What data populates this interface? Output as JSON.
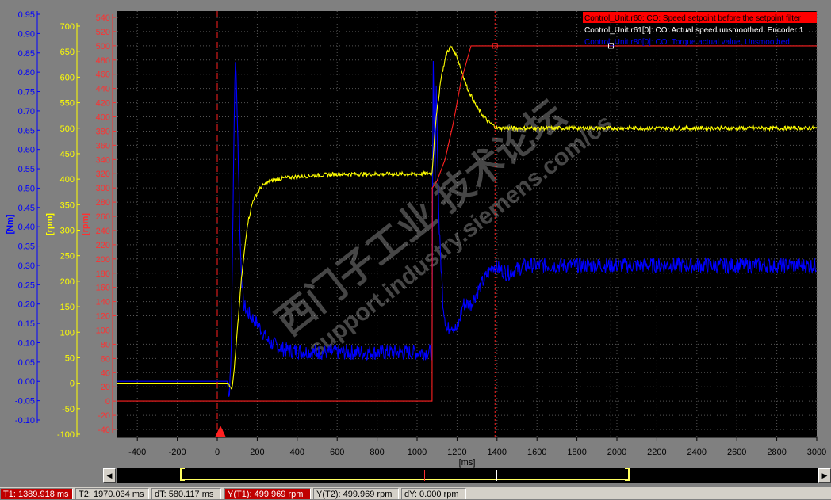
{
  "chart_data": {
    "type": "line",
    "x": {
      "label": "[ms]",
      "range": [
        -500,
        3000
      ],
      "ticks": [
        "-400",
        "-200",
        "0",
        "200",
        "400",
        "600",
        "800",
        "1000",
        "1200",
        "1400",
        "1600",
        "1800",
        "2000",
        "2200",
        "2400",
        "2600",
        "2800",
        "3000"
      ]
    },
    "axes": {
      "torque": {
        "label": "[Nm]",
        "color": "#0000ff",
        "range": [
          -0.1,
          0.95
        ],
        "ticks": [
          "0.95",
          "0.90",
          "0.85",
          "0.80",
          "0.75",
          "0.70",
          "0.65",
          "0.60",
          "0.55",
          "0.50",
          "0.45",
          "0.40",
          "0.35",
          "0.30",
          "0.25",
          "0.20",
          "0.15",
          "0.10",
          "0.05",
          "0.00",
          "-0.05",
          "-0.10"
        ]
      },
      "speed": {
        "label": "[rpm]",
        "color": "#ffff00",
        "range": [
          -100,
          700
        ],
        "ticks": [
          "700",
          "650",
          "600",
          "550",
          "500",
          "450",
          "400",
          "350",
          "300",
          "250",
          "200",
          "150",
          "100",
          "50",
          "0",
          "-50",
          "-100"
        ]
      },
      "setpoint": {
        "label": "[rpm]",
        "color": "#ff3030",
        "range": [
          -40,
          540
        ],
        "ticks": [
          "540",
          "520",
          "500",
          "480",
          "460",
          "440",
          "420",
          "400",
          "380",
          "360",
          "340",
          "320",
          "300",
          "280",
          "260",
          "240",
          "220",
          "200",
          "180",
          "160",
          "140",
          "120",
          "100",
          "80",
          "60",
          "40",
          "20",
          "0",
          "-20",
          "-40"
        ]
      }
    },
    "series": [
      {
        "name": "Control_Unit.r60: CO: Speed setpoint before the setpoint filter",
        "color": "#ff2020",
        "axis": "setpoint",
        "noise": 0,
        "x": [
          -500,
          1075,
          1076,
          1100,
          1140,
          1180,
          1220,
          1270,
          3000
        ],
        "y": [
          0,
          0,
          300,
          310,
          340,
          390,
          450,
          500,
          500
        ]
      },
      {
        "name": "Control_Unit.r61[0]: CO: Actual speed unsmoothed, Encoder 1",
        "color": "#ffff00",
        "axis": "speed",
        "noise": 4,
        "x": [
          -500,
          55,
          75,
          90,
          120,
          150,
          180,
          220,
          260,
          300,
          400,
          600,
          800,
          1000,
          1075,
          1090,
          1120,
          1150,
          1170,
          1200,
          1250,
          1300,
          1350,
          1400,
          1500,
          3000
        ],
        "y": [
          0,
          0,
          -10,
          50,
          200,
          310,
          360,
          385,
          395,
          400,
          405,
          410,
          410,
          410,
          412,
          500,
          600,
          650,
          660,
          640,
          580,
          540,
          515,
          500,
          500,
          500
        ]
      },
      {
        "name": "Control_Unit.r80[0]: CO: Torque actual value, Unsmoothed",
        "color": "#0000ff",
        "axis": "torque",
        "noise": 0.02,
        "x": [
          -500,
          50,
          60,
          70,
          80,
          90,
          100,
          115,
          130,
          150,
          200,
          260,
          350,
          500,
          700,
          900,
          1075,
          1080,
          1090,
          1095,
          1110,
          1130,
          1150,
          1170,
          1200,
          1230,
          1270,
          1320,
          1380,
          1450,
          1550,
          1700,
          2000,
          3000
        ],
        "y": [
          0,
          0,
          -0.05,
          0.1,
          0.5,
          0.85,
          0.7,
          0.35,
          0.2,
          0.18,
          0.15,
          0.1,
          0.08,
          0.075,
          0.075,
          0.075,
          0.075,
          0.85,
          0.5,
          0.8,
          0.4,
          0.2,
          0.13,
          0.15,
          0.13,
          0.2,
          0.2,
          0.25,
          0.3,
          0.28,
          0.3,
          0.3,
          0.3,
          0.3
        ]
      }
    ],
    "cursors": {
      "t1": 1389.918,
      "t2": 1970.034
    },
    "legend_position": "top-right",
    "grid": true,
    "watermark": [
      "西门子工业 技术论坛",
      "support.industry.siemens.com/cs"
    ]
  },
  "status": {
    "t1": "T1: 1389.918 ms",
    "t2": "T2: 1970.034 ms",
    "dt": "dT: 580.117 ms",
    "yt1": "Y(T1): 499.969 rpm",
    "yt2": "Y(T2): 499.969 rpm",
    "dy": "dY: 0.000 rpm"
  },
  "colors": {
    "plot_bg": "#000000",
    "window_bg": "#808080",
    "grid": "#505050"
  },
  "icons": {
    "scroll_left": "left-arrow-icon",
    "scroll_right": "right-arrow-icon",
    "trigger": "trigger-marker-icon"
  }
}
